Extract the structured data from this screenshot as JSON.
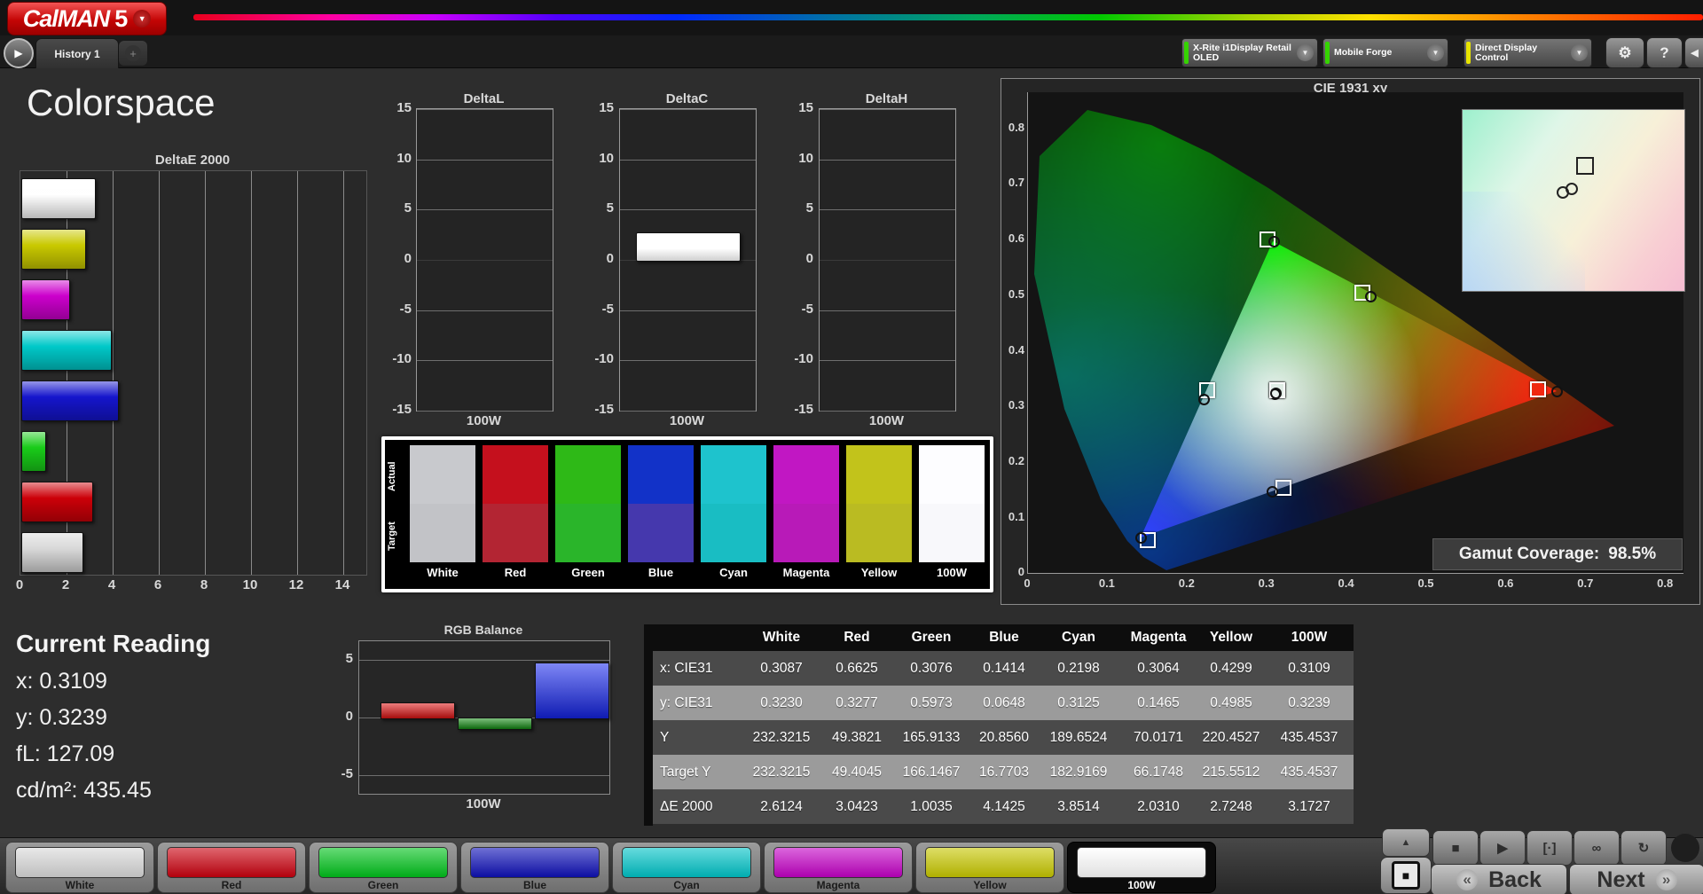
{
  "header": {
    "brand": "CalMAN",
    "brand_version": "5",
    "tab": "History 1",
    "meters": [
      {
        "label_line1": "X-Rite i1Display Retail",
        "label_line2": "OLED",
        "stripe_color": "#35d400"
      },
      {
        "label_line1": "Mobile Forge",
        "label_line2": "",
        "stripe_color": "#35d400"
      },
      {
        "label_line1": "Direct Display Control",
        "label_line2": "",
        "stripe_color": "#e8e400"
      }
    ]
  },
  "icons": {
    "logo_arrow": "▼",
    "tab_arrow": "▶",
    "add_tab": "+",
    "dropdown_arrow": "▼",
    "gear": "⚙",
    "help": "?",
    "collapse": "◀",
    "panel_up": "▲",
    "pattern_window": "■",
    "back_chevron": "«",
    "next_chevron": "»"
  },
  "page": {
    "title": "Colorspace"
  },
  "current_reading": {
    "title": "Current Reading",
    "readings": [
      {
        "label": "x:",
        "value": "0.3109"
      },
      {
        "label": "y:",
        "value": "0.3239"
      },
      {
        "label": "fL:",
        "value": "127.09"
      },
      {
        "label": "cd/m²:",
        "value": "435.45"
      }
    ]
  },
  "swatch_panel": {
    "actual_label": "Actual",
    "target_label": "Target",
    "columns": [
      {
        "name": "White",
        "actual": "#c8c9cd",
        "target": "#c2c3c7"
      },
      {
        "name": "Red",
        "actual": "#c5101d",
        "target": "#b32533"
      },
      {
        "name": "Green",
        "actual": "#2eb917",
        "target": "#2ab52a"
      },
      {
        "name": "Blue",
        "actual": "#1232c8",
        "target": "#4538ad"
      },
      {
        "name": "Cyan",
        "actual": "#1ec3cd",
        "target": "#19bdc3"
      },
      {
        "name": "Magenta",
        "actual": "#c117c3",
        "target": "#b81ab8"
      },
      {
        "name": "Yellow",
        "actual": "#c2c31b",
        "target": "#babb22"
      },
      {
        "name": "100W",
        "actual": "#fdfdff",
        "target": "#f8f8fb"
      }
    ]
  },
  "results_table": {
    "columns": [
      "White",
      "Red",
      "Green",
      "Blue",
      "Cyan",
      "Magenta",
      "Yellow",
      "100W"
    ],
    "rows": [
      {
        "label": "x: CIE31",
        "values": [
          "0.3087",
          "0.6625",
          "0.3076",
          "0.1414",
          "0.2198",
          "0.3064",
          "0.4299",
          "0.3109"
        ]
      },
      {
        "label": "y: CIE31",
        "values": [
          "0.3230",
          "0.3277",
          "0.5973",
          "0.0648",
          "0.3125",
          "0.1465",
          "0.4985",
          "0.3239"
        ]
      },
      {
        "label": "Y",
        "values": [
          "232.3215",
          "49.3821",
          "165.9133",
          "20.8560",
          "189.6524",
          "70.0171",
          "220.4527",
          "435.4537"
        ]
      },
      {
        "label": "Target Y",
        "values": [
          "232.3215",
          "49.4045",
          "166.1467",
          "16.7703",
          "182.9169",
          "66.1748",
          "215.5512",
          "435.4537"
        ]
      },
      {
        "label": "ΔE 2000",
        "values": [
          "2.6124",
          "3.0423",
          "1.0035",
          "4.1425",
          "3.8514",
          "2.0310",
          "2.7248",
          "3.1727"
        ]
      }
    ]
  },
  "pattern_bar": {
    "buttons": [
      {
        "label": "White",
        "color": "#d9d9d9",
        "selected": false
      },
      {
        "label": "Red",
        "color": "#cb000e",
        "selected": false
      },
      {
        "label": "Green",
        "color": "#00c31b",
        "selected": false
      },
      {
        "label": "Blue",
        "color": "#0e10b8",
        "selected": false
      },
      {
        "label": "Cyan",
        "color": "#00c4c8",
        "selected": false
      },
      {
        "label": "Magenta",
        "color": "#c400c6",
        "selected": false
      },
      {
        "label": "Yellow",
        "color": "#c8c800",
        "selected": false
      },
      {
        "label": "100W",
        "color": "#ffffff",
        "selected": true
      }
    ]
  },
  "transport": {
    "buttons": [
      {
        "name": "stop",
        "glyph": "■"
      },
      {
        "name": "play",
        "glyph": "▶"
      },
      {
        "name": "single-measure",
        "glyph": "[·]"
      },
      {
        "name": "continuous-measure",
        "glyph": "∞"
      },
      {
        "name": "refresh",
        "glyph": "↻"
      }
    ],
    "back_label": "Back",
    "next_label": "Next"
  },
  "chart_data": [
    {
      "id": "deltae2000",
      "type": "bar",
      "orientation": "horizontal",
      "title": "DeltaE 2000",
      "xlim": [
        0,
        15
      ],
      "xticks": [
        0,
        2,
        4,
        6,
        8,
        10,
        12,
        14
      ],
      "grid": true,
      "categories": [
        "100W",
        "Yellow",
        "Magenta",
        "Cyan",
        "Blue",
        "Green",
        "Red",
        "White"
      ],
      "values": [
        3.1727,
        2.7248,
        2.031,
        3.8514,
        4.1425,
        1.0035,
        3.0423,
        2.6124
      ],
      "colors": [
        "#ffffff",
        "#c9c900",
        "#cc00cc",
        "#00c9c9",
        "#1515cc",
        "#19cc19",
        "#cc0008",
        "#d8d8d8"
      ]
    },
    {
      "id": "deltaL",
      "type": "bar",
      "title": "DeltaL",
      "ylim": [
        -15,
        15
      ],
      "yticks": [
        15,
        10,
        5,
        0,
        -5,
        -10,
        -15
      ],
      "categories": [
        "100W"
      ],
      "values": [
        0
      ],
      "xlabel": "100W",
      "colors": [
        "#ffffff"
      ]
    },
    {
      "id": "deltaC",
      "type": "bar",
      "title": "DeltaC",
      "ylim": [
        -15,
        15
      ],
      "yticks": [
        15,
        10,
        5,
        0,
        -5,
        -10,
        -15
      ],
      "categories": [
        "100W"
      ],
      "values": [
        2.7
      ],
      "xlabel": "100W",
      "colors": [
        "#ffffff"
      ]
    },
    {
      "id": "deltaH",
      "type": "bar",
      "title": "DeltaH",
      "ylim": [
        -15,
        15
      ],
      "yticks": [
        15,
        10,
        5,
        0,
        -5,
        -10,
        -15
      ],
      "categories": [
        "100W"
      ],
      "values": [
        0
      ],
      "xlabel": "100W",
      "colors": [
        "#ffffff"
      ]
    },
    {
      "id": "rgb_balance",
      "type": "bar",
      "title": "RGB Balance",
      "ylim": [
        -6.5,
        6.5
      ],
      "yticks": [
        5,
        0,
        -5
      ],
      "xlabel": "100W",
      "series": [
        {
          "name": "Red",
          "value": 1.3,
          "color": "#dd1111"
        },
        {
          "name": "Green",
          "value": -0.9,
          "color": "#128a12"
        },
        {
          "name": "Blue",
          "value": 4.8,
          "color": "#1424ee"
        }
      ]
    },
    {
      "id": "cie1931",
      "type": "scatter",
      "title": "CIE 1931 xy",
      "xlim": [
        0,
        0.8222
      ],
      "ylim": [
        0,
        0.865
      ],
      "xticks": [
        0,
        0.1,
        0.2,
        0.3,
        0.4,
        0.5,
        0.6,
        0.7,
        0.8
      ],
      "yticks": [
        0.8,
        0.7,
        0.6,
        0.5,
        0.4,
        0.3,
        0.2,
        0.1,
        0
      ],
      "gamut_label": "Gamut Coverage:",
      "gamut_value": "98.5%",
      "points": [
        {
          "name": "White",
          "target": [
            0.3127,
            0.329
          ],
          "measured": [
            0.3087,
            0.323
          ]
        },
        {
          "name": "Red",
          "target": [
            0.64,
            0.33
          ],
          "measured": [
            0.6625,
            0.3277
          ]
        },
        {
          "name": "Green",
          "target": [
            0.3,
            0.6
          ],
          "measured": [
            0.3076,
            0.5973
          ]
        },
        {
          "name": "Blue",
          "target": [
            0.15,
            0.06
          ],
          "measured": [
            0.1414,
            0.0648
          ]
        },
        {
          "name": "Cyan",
          "target": [
            0.2246,
            0.3287
          ],
          "measured": [
            0.2198,
            0.3125
          ]
        },
        {
          "name": "Magenta",
          "target": [
            0.3209,
            0.1542
          ],
          "measured": [
            0.3064,
            0.1465
          ]
        },
        {
          "name": "Yellow",
          "target": [
            0.4193,
            0.5053
          ],
          "measured": [
            0.4299,
            0.4985
          ]
        },
        {
          "name": "100W",
          "target": [
            0.3127,
            0.329
          ],
          "measured": [
            0.3109,
            0.3239
          ]
        }
      ]
    }
  ]
}
